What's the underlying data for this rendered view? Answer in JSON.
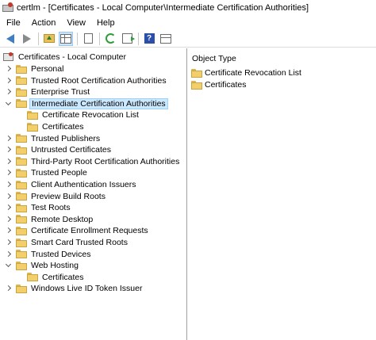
{
  "window": {
    "title": "certlm - [Certificates - Local Computer\\Intermediate Certification Authorities]"
  },
  "menu": [
    "File",
    "Action",
    "View",
    "Help"
  ],
  "toolbar": {
    "icons": [
      "back-arrow-icon",
      "forward-arrow-icon",
      "up-folder-icon",
      "show-hide-tree-icon",
      "properties-icon",
      "refresh-icon",
      "export-list-icon",
      "help-icon",
      "action-pane-icon"
    ]
  },
  "tree": {
    "root": "Certificates - Local Computer",
    "items": [
      {
        "label": "Personal",
        "level": 1,
        "expanded": false
      },
      {
        "label": "Trusted Root Certification Authorities",
        "level": 1,
        "expanded": false
      },
      {
        "label": "Enterprise Trust",
        "level": 1,
        "expanded": false
      },
      {
        "label": "Intermediate Certification Authorities",
        "level": 1,
        "expanded": true,
        "selected": true
      },
      {
        "label": "Certificate Revocation List",
        "level": 2,
        "leaf": true
      },
      {
        "label": "Certificates",
        "level": 2,
        "leaf": true
      },
      {
        "label": "Trusted Publishers",
        "level": 1,
        "expanded": false
      },
      {
        "label": "Untrusted Certificates",
        "level": 1,
        "expanded": false
      },
      {
        "label": "Third-Party Root Certification Authorities",
        "level": 1,
        "expanded": false
      },
      {
        "label": "Trusted People",
        "level": 1,
        "expanded": false
      },
      {
        "label": "Client Authentication Issuers",
        "level": 1,
        "expanded": false
      },
      {
        "label": "Preview Build Roots",
        "level": 1,
        "expanded": false
      },
      {
        "label": "Test Roots",
        "level": 1,
        "expanded": false
      },
      {
        "label": "Remote Desktop",
        "level": 1,
        "expanded": false
      },
      {
        "label": "Certificate Enrollment Requests",
        "level": 1,
        "expanded": false
      },
      {
        "label": "Smart Card Trusted Roots",
        "level": 1,
        "expanded": false
      },
      {
        "label": "Trusted Devices",
        "level": 1,
        "expanded": false
      },
      {
        "label": "Web Hosting",
        "level": 1,
        "expanded": true
      },
      {
        "label": "Certificates",
        "level": 2,
        "leaf": true
      },
      {
        "label": "Windows Live ID Token Issuer",
        "level": 1,
        "expanded": false
      }
    ]
  },
  "list": {
    "column": "Object Type",
    "rows": [
      "Certificate Revocation List",
      "Certificates"
    ]
  },
  "colors": {
    "selection_bg": "#cce8ff",
    "selection_border": "#99d1ff",
    "folder": "#f3cf6b"
  }
}
